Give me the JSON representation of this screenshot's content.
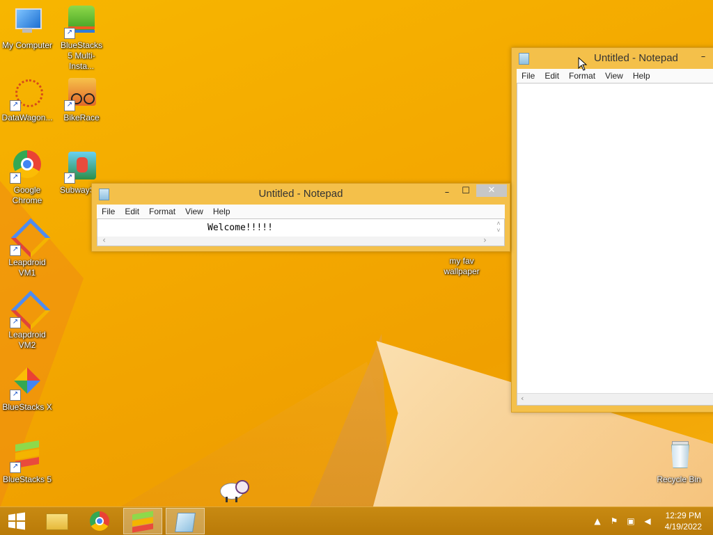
{
  "desktop_icons": [
    {
      "label": "My Computer"
    },
    {
      "label": "BlueStacks 5 Multi-Insta..."
    },
    {
      "label": "DataWagon..."
    },
    {
      "label": "BikeRace"
    },
    {
      "label": "Google Chrome"
    },
    {
      "label": "SubwayS"
    },
    {
      "label": "Leapdroid VM1"
    },
    {
      "label": "Leapdroid VM2"
    },
    {
      "label": "BlueStacks X"
    },
    {
      "label": "BlueStacks 5"
    },
    {
      "label": "my fav wallpaper"
    },
    {
      "label": "Recycle Bin"
    }
  ],
  "notepad_small": {
    "title": "Untitled - Notepad",
    "menu": [
      "File",
      "Edit",
      "Format",
      "View",
      "Help"
    ],
    "content": "Welcome!!!!!"
  },
  "notepad_large": {
    "title": "Untitled - Notepad",
    "menu": [
      "File",
      "Edit",
      "Format",
      "View",
      "Help"
    ]
  },
  "window_controls": {
    "minimize": "–",
    "maximize": "☐",
    "close": "✕"
  },
  "taskbar": {
    "items": [
      "start-icon",
      "file-explorer-icon",
      "chrome-icon",
      "bluestacks-icon",
      "notepad-icon"
    ],
    "time": "12:29 PM",
    "date": "4/19/2022"
  },
  "colors": {
    "wallpaper": "#f4a900",
    "taskbar": "#c88a12"
  }
}
